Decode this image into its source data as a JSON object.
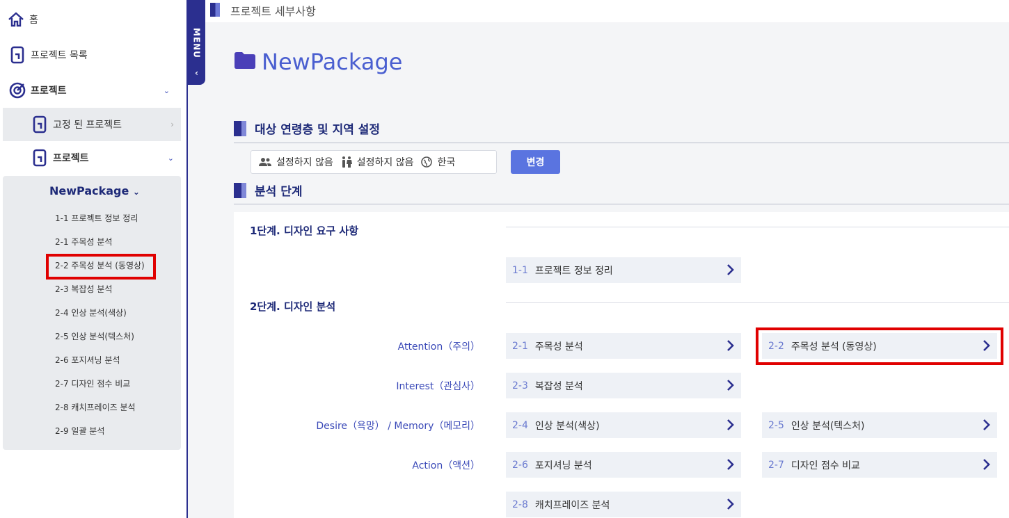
{
  "sidebar": {
    "home": "홈",
    "project_list": "프로젝트 목록",
    "projects": "프로젝트",
    "pinned": "고정 된 프로젝트",
    "project_sub": "프로젝트",
    "menu_tab": "MENU",
    "package": {
      "name": "NewPackage",
      "steps": [
        "1-1 프로젝트 정보 정리",
        "2-1 주목성 분석",
        "2-2 주목성 분석 (동영상)",
        "2-3 복잡성 분석",
        "2-4 인상 분석(색상)",
        "2-5 인상 분석(텍스처)",
        "2-6 포지셔닝 분석",
        "2-7 디자인 점수 비교",
        "2-8 캐치프레이즈 분석",
        "2-9 일괄 분석"
      ]
    }
  },
  "header": {
    "title": "프로젝트 세부사항"
  },
  "project": {
    "title": "NewPackage"
  },
  "target": {
    "heading": "대상 연령층 및 지역 설정",
    "age": "설정하지 않음",
    "gender": "설정하지 않음",
    "region": "한국",
    "change_label": "변경"
  },
  "analysis": {
    "heading": "분석 단계",
    "stage1": {
      "title": "1단계. 디자인 요구 사항",
      "step_1_1": {
        "num": "1-1",
        "label": "프로젝트 정보 정리"
      }
    },
    "stage2": {
      "title": "2단계. 디자인 분석",
      "rows": {
        "attention": "Attention（주의）",
        "interest": "Interest（관심사）",
        "desire": "Desire（욕망） / Memory（메모리）",
        "action": "Action（액션）"
      },
      "steps": {
        "s2_1": {
          "num": "2-1",
          "label": "주목성 분석"
        },
        "s2_2": {
          "num": "2-2",
          "label": "주목성 분석 (동영상)"
        },
        "s2_3": {
          "num": "2-3",
          "label": "복잡성 분석"
        },
        "s2_4": {
          "num": "2-4",
          "label": "인상 분석(색상)"
        },
        "s2_5": {
          "num": "2-5",
          "label": "인상 분석(텍스처)"
        },
        "s2_6": {
          "num": "2-6",
          "label": "포지셔닝 분석"
        },
        "s2_7": {
          "num": "2-7",
          "label": "디자인 점수 비교"
        },
        "s2_8": {
          "num": "2-8",
          "label": "캐치프레이즈 분석"
        }
      }
    }
  },
  "colors": {
    "accent": "#2b2f8f",
    "link": "#4a5fd0",
    "highlight": "#e00000",
    "button": "#5a74e0"
  }
}
